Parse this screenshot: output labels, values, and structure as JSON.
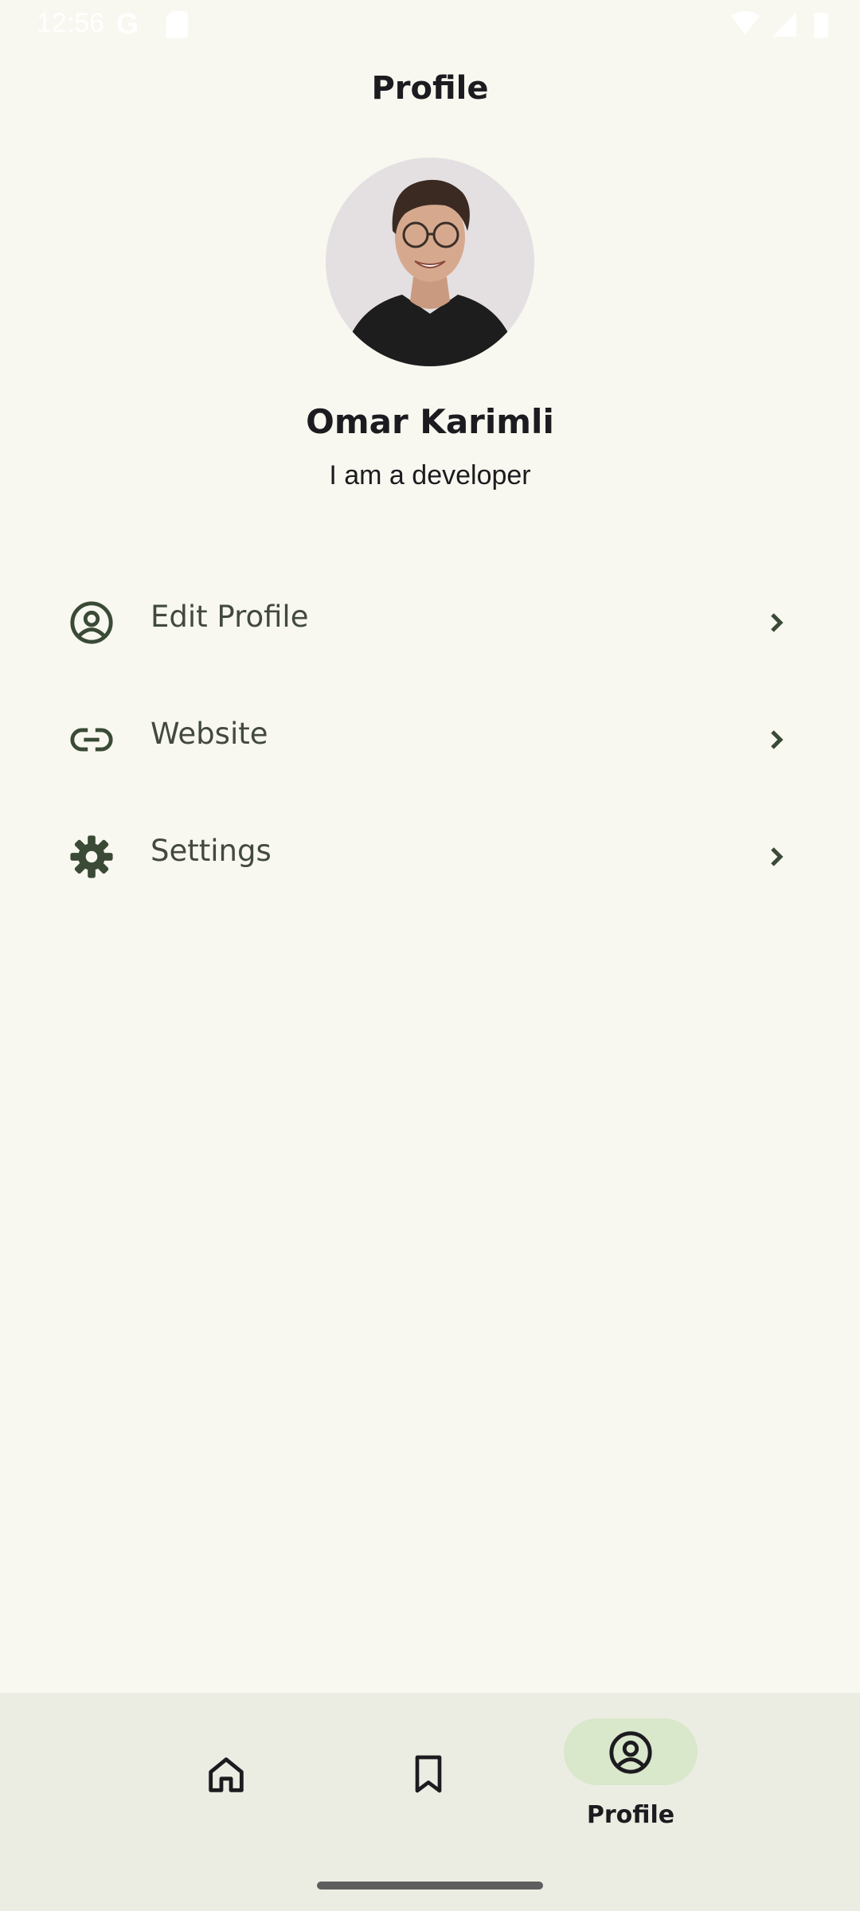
{
  "status_bar": {
    "time": "12:56",
    "google_icon_letter": "G"
  },
  "header": {
    "title": "Profile"
  },
  "profile": {
    "name": "Omar Karimli",
    "bio": "I am a developer"
  },
  "menu": {
    "items": [
      {
        "label": "Edit Profile",
        "icon": "account-circle-icon"
      },
      {
        "label": "Website",
        "icon": "link-icon"
      },
      {
        "label": "Settings",
        "icon": "gear-icon"
      }
    ]
  },
  "bottom_nav": {
    "items": [
      {
        "icon": "home-icon",
        "label": "",
        "selected": false
      },
      {
        "icon": "bookmark-icon",
        "label": "",
        "selected": false
      },
      {
        "icon": "account-circle-icon",
        "label": "Profile",
        "selected": true
      }
    ]
  },
  "colors": {
    "background": "#F8F8F0",
    "nav_background": "#ECEDE2",
    "nav_active_pill": "#D9E7CB",
    "icon_dark": "#3A4A36",
    "text": "#1C1B1F"
  }
}
